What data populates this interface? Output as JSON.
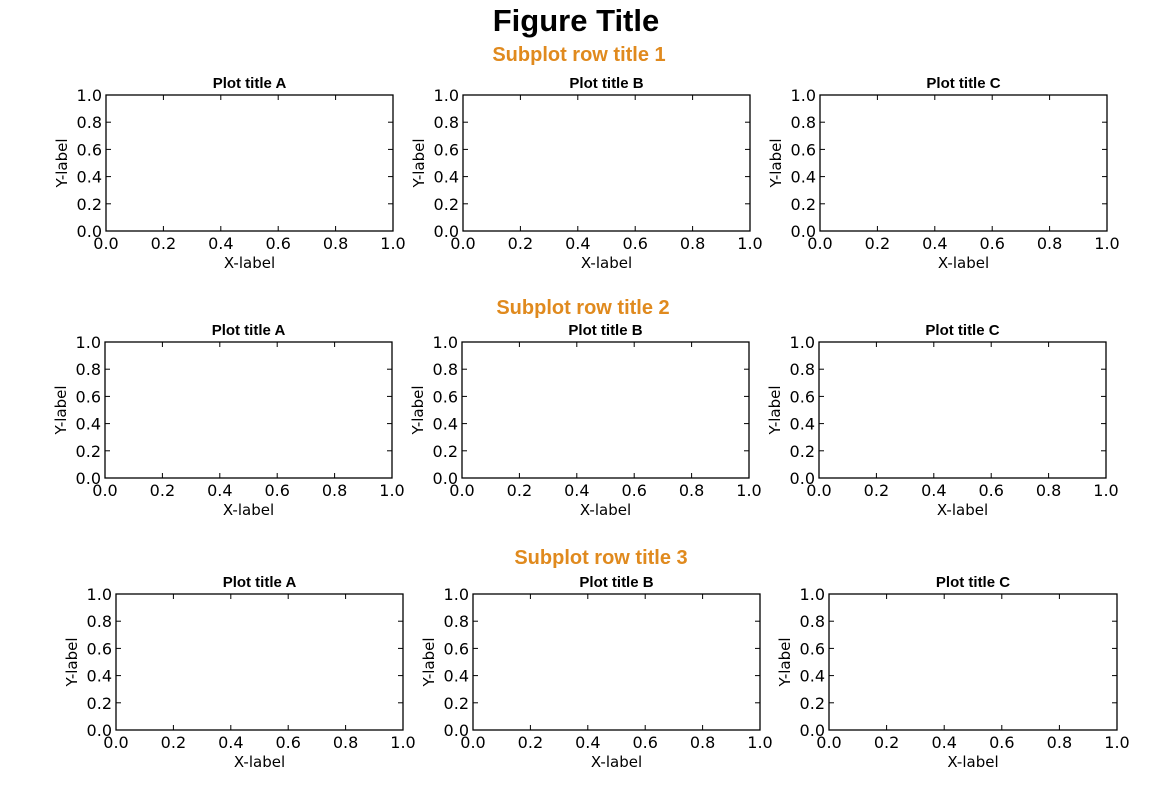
{
  "figure_title": "Figure Title",
  "accent_color": "#e08a1e",
  "chart_data": [
    {
      "type": "line",
      "row": 1,
      "row_title": "Subplot row title 1",
      "title": "Plot title A",
      "xlabel": "X-label",
      "ylabel": "Y-label",
      "xlim": [
        0,
        1
      ],
      "ylim": [
        0,
        1
      ],
      "xticks": [
        "0.0",
        "0.2",
        "0.4",
        "0.6",
        "0.8",
        "1.0"
      ],
      "yticks": [
        "0.0",
        "0.2",
        "0.4",
        "0.6",
        "0.8",
        "1.0"
      ],
      "series": [],
      "grid": false
    },
    {
      "type": "line",
      "row": 1,
      "row_title": "Subplot row title 1",
      "title": "Plot title B",
      "xlabel": "X-label",
      "ylabel": "Y-label",
      "xlim": [
        0,
        1
      ],
      "ylim": [
        0,
        1
      ],
      "xticks": [
        "0.0",
        "0.2",
        "0.4",
        "0.6",
        "0.8",
        "1.0"
      ],
      "yticks": [
        "0.0",
        "0.2",
        "0.4",
        "0.6",
        "0.8",
        "1.0"
      ],
      "series": [],
      "grid": false
    },
    {
      "type": "line",
      "row": 1,
      "row_title": "Subplot row title 1",
      "title": "Plot title C",
      "xlabel": "X-label",
      "ylabel": "Y-label",
      "xlim": [
        0,
        1
      ],
      "ylim": [
        0,
        1
      ],
      "xticks": [
        "0.0",
        "0.2",
        "0.4",
        "0.6",
        "0.8",
        "1.0"
      ],
      "yticks": [
        "0.0",
        "0.2",
        "0.4",
        "0.6",
        "0.8",
        "1.0"
      ],
      "series": [],
      "grid": false
    },
    {
      "type": "line",
      "row": 2,
      "row_title": "Subplot row title 2",
      "title": "Plot title A",
      "xlabel": "X-label",
      "ylabel": "Y-label",
      "xlim": [
        0,
        1
      ],
      "ylim": [
        0,
        1
      ],
      "xticks": [
        "0.0",
        "0.2",
        "0.4",
        "0.6",
        "0.8",
        "1.0"
      ],
      "yticks": [
        "0.0",
        "0.2",
        "0.4",
        "0.6",
        "0.8",
        "1.0"
      ],
      "series": [],
      "grid": false
    },
    {
      "type": "line",
      "row": 2,
      "row_title": "Subplot row title 2",
      "title": "Plot title B",
      "xlabel": "X-label",
      "ylabel": "Y-label",
      "xlim": [
        0,
        1
      ],
      "ylim": [
        0,
        1
      ],
      "xticks": [
        "0.0",
        "0.2",
        "0.4",
        "0.6",
        "0.8",
        "1.0"
      ],
      "yticks": [
        "0.0",
        "0.2",
        "0.4",
        "0.6",
        "0.8",
        "1.0"
      ],
      "series": [],
      "grid": false
    },
    {
      "type": "line",
      "row": 2,
      "row_title": "Subplot row title 2",
      "title": "Plot title C",
      "xlabel": "X-label",
      "ylabel": "Y-label",
      "xlim": [
        0,
        1
      ],
      "ylim": [
        0,
        1
      ],
      "xticks": [
        "0.0",
        "0.2",
        "0.4",
        "0.6",
        "0.8",
        "1.0"
      ],
      "yticks": [
        "0.0",
        "0.2",
        "0.4",
        "0.6",
        "0.8",
        "1.0"
      ],
      "series": [],
      "grid": false
    },
    {
      "type": "line",
      "row": 3,
      "row_title": "Subplot row title 3",
      "title": "Plot title A",
      "xlabel": "X-label",
      "ylabel": "Y-label",
      "xlim": [
        0,
        1
      ],
      "ylim": [
        0,
        1
      ],
      "xticks": [
        "0.0",
        "0.2",
        "0.4",
        "0.6",
        "0.8",
        "1.0"
      ],
      "yticks": [
        "0.0",
        "0.2",
        "0.4",
        "0.6",
        "0.8",
        "1.0"
      ],
      "series": [],
      "grid": false
    },
    {
      "type": "line",
      "row": 3,
      "row_title": "Subplot row title 3",
      "title": "Plot title B",
      "xlabel": "X-label",
      "ylabel": "Y-label",
      "xlim": [
        0,
        1
      ],
      "ylim": [
        0,
        1
      ],
      "xticks": [
        "0.0",
        "0.2",
        "0.4",
        "0.6",
        "0.8",
        "1.0"
      ],
      "yticks": [
        "0.0",
        "0.2",
        "0.4",
        "0.6",
        "0.8",
        "1.0"
      ],
      "series": [],
      "grid": false
    },
    {
      "type": "line",
      "row": 3,
      "row_title": "Subplot row title 3",
      "title": "Plot title C",
      "xlabel": "X-label",
      "ylabel": "Y-label",
      "xlim": [
        0,
        1
      ],
      "ylim": [
        0,
        1
      ],
      "xticks": [
        "0.0",
        "0.2",
        "0.4",
        "0.6",
        "0.8",
        "1.0"
      ],
      "yticks": [
        "0.0",
        "0.2",
        "0.4",
        "0.6",
        "0.8",
        "1.0"
      ],
      "series": [],
      "grid": false
    }
  ]
}
